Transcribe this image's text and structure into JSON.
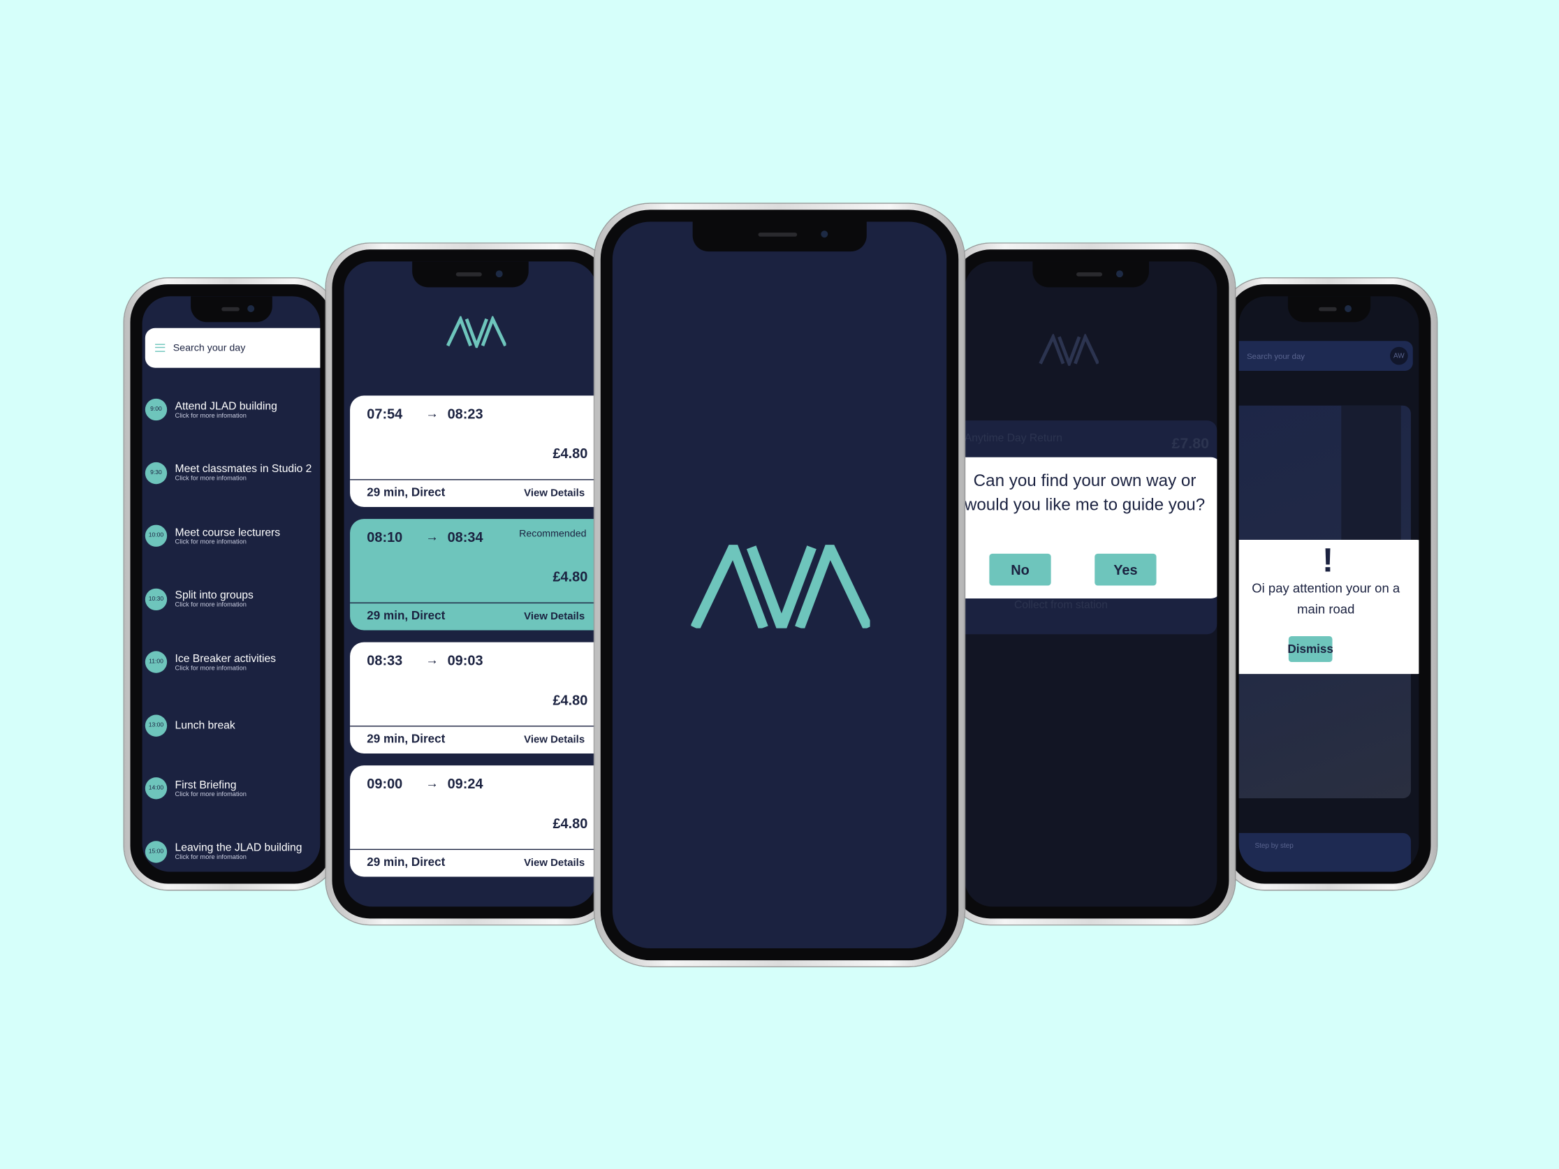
{
  "brand": {
    "logo_text": "AVA",
    "accent": "#6ec5bc",
    "navy": "#1b2240",
    "background": "#d6fffa"
  },
  "schedule": {
    "search_placeholder": "Search your day",
    "events": [
      {
        "time": "9:00",
        "title": "Attend JLAD building",
        "sub": "Click for more infomation"
      },
      {
        "time": "9:30",
        "title": "Meet classmates in Studio 2",
        "sub": "Click for more infomation"
      },
      {
        "time": "10:00",
        "title": "Meet course lecturers",
        "sub": "Click for more infomation"
      },
      {
        "time": "10:30",
        "title": "Split into groups",
        "sub": "Click for more infomation"
      },
      {
        "time": "11:00",
        "title": "Ice Breaker activities",
        "sub": "Click for more infomation"
      },
      {
        "time": "13:00",
        "title": "Lunch break",
        "sub": ""
      },
      {
        "time": "14:00",
        "title": "First Briefing",
        "sub": "Click for more infomation"
      },
      {
        "time": "15:00",
        "title": "Leaving the JLAD building",
        "sub": "Click for more infomation"
      }
    ]
  },
  "trains": {
    "arrow": "→",
    "journeys": [
      {
        "depart": "07:54",
        "arrive": "08:23",
        "price": "£4.80",
        "duration": "29 min, Direct",
        "details": "View Details",
        "label": ""
      },
      {
        "depart": "08:10",
        "arrive": "08:34",
        "price": "£4.80",
        "duration": "29 min, Direct",
        "details": "View Details",
        "label": "Recommended"
      },
      {
        "depart": "08:33",
        "arrive": "09:03",
        "price": "£4.80",
        "duration": "29 min, Direct",
        "details": "View Details",
        "label": ""
      },
      {
        "depart": "09:00",
        "arrive": "09:24",
        "price": "£4.80",
        "duration": "29 min, Direct",
        "details": "View Details",
        "label": ""
      }
    ]
  },
  "guide_dialog": {
    "ticket_name": "Anytime Day Return",
    "ticket_price": "£7.80",
    "collect": "Collect from station",
    "question": "Can you find your own way or would you like me to guide you?",
    "no": "No",
    "yes": "Yes"
  },
  "alert": {
    "search_placeholder": "Search your day",
    "avatar": "AW",
    "icon": "exclamation-icon",
    "mark": "!",
    "message": "Oi pay attention your on a main road",
    "dismiss": "Dismiss",
    "step": "Step by step"
  }
}
